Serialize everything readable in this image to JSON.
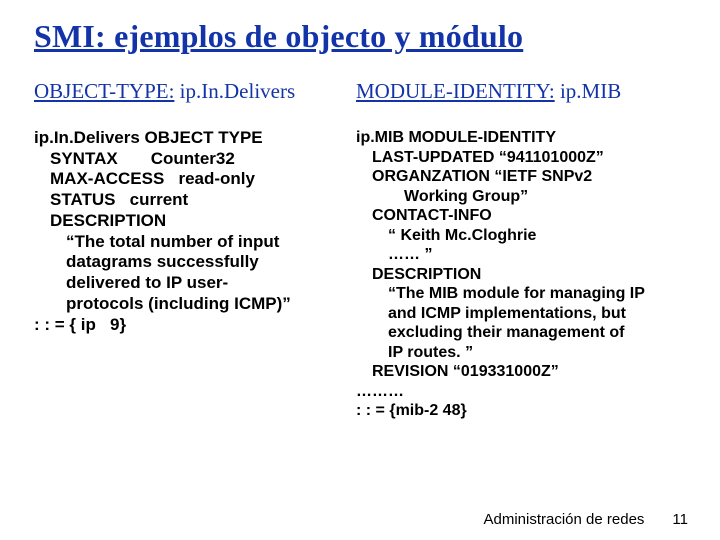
{
  "title": "SMI: ejemplos de objecto y módulo",
  "left": {
    "subhead_label": "OBJECT-TYPE:",
    "subhead_value": " ip.In.Delivers",
    "body_html": "<div class='line bold'>ip.In.Delivers OBJECT TYPE</div><div class='line bold indent1'>SYNTAX       Counter32</div><div class='line bold indent1'>MAX-ACCESS   read-only</div><div class='line bold indent1'>STATUS   current</div><div class='line bold indent1'>DESCRIPTION</div><div class='line bold indent2'>“The total number of input</div><div class='line bold indent2'>datagrams successfully</div><div class='line bold indent2'>delivered to IP user-</div><div class='line bold indent2'>protocols (including ICMP)”</div><div class='line bold'>: : = { ip   9}</div>"
  },
  "right": {
    "subhead_label": "MODULE-IDENTITY:",
    "subhead_value": " ip.MIB",
    "body_html": "<div class='line bold'>ip.MIB MODULE-IDENTITY</div><div class='line bold indent1'>LAST-UPDATED “941101000Z”</div><div class='line bold indent1'>ORGANZATION “IETF SNPv2</div><div class='line bold indent3'>Working Group”</div><div class='line bold indent1'>CONTACT-INFO</div><div class='line bold indent2'>“ Keith Mc.Cloghrie</div><div class='line bold indent2'>…… ”</div><div class='line bold indent1'>DESCRIPTION</div><div class='line bold indent2'>“The MIB module for managing IP</div><div class='line bold indent2'>and ICMP implementations, but</div><div class='line bold indent2'>excluding their management of</div><div class='line bold indent2'>IP routes. ”</div><div class='line bold indent1'>REVISION “019331000Z”</div><div class='line bold'>………</div><div class='line bold'>: : = {mib-2 48}</div>"
  },
  "footer": {
    "label": "Administración de redes",
    "num": "11"
  }
}
